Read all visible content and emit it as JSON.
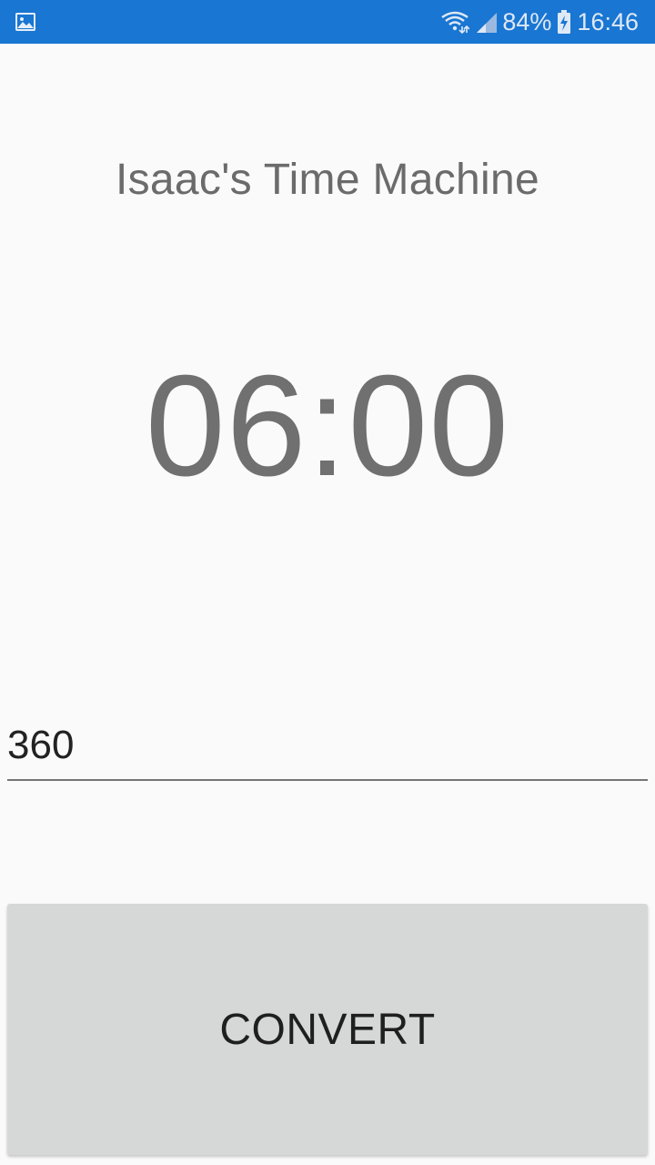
{
  "status_bar": {
    "battery_percent": "84%",
    "time": "16:46",
    "background_color": "#1976d2",
    "icons": [
      "image-notification-icon",
      "wifi-icon",
      "signal-icon",
      "battery-charging-icon"
    ]
  },
  "app": {
    "title": "Isaac's Time Machine",
    "time_display": "06:00"
  },
  "input": {
    "value": "360"
  },
  "button": {
    "label": "CONVERT"
  }
}
